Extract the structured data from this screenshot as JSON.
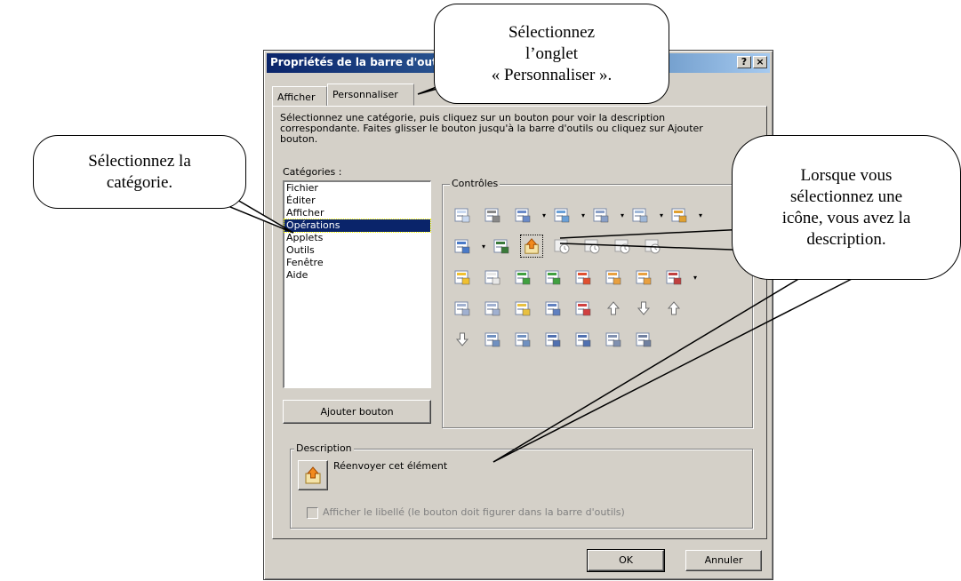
{
  "dialog": {
    "title": "Propriétés de la barre d'outils",
    "help_button": "?",
    "close_button": "×",
    "tabs": [
      "Afficher",
      "Personnaliser"
    ],
    "active_tab": "Personnaliser",
    "instructions": "Sélectionnez une catégorie, puis cliquez sur un bouton pour voir la description correspondante. Faites glisser le bouton jusqu'à la barre d'outils ou cliquez sur Ajouter bouton.",
    "categories_label": "Catégories :",
    "categories": [
      "Fichier",
      "Éditer",
      "Afficher",
      "Opérations",
      "Applets",
      "Outils",
      "Fenêtre",
      "Aide"
    ],
    "selected_category": "Opérations",
    "controls_label": "Contrôles",
    "add_button": "Ajouter bouton",
    "description_label": "Description",
    "description_text": "Réenvoyer cet élément",
    "show_label_checkbox": "Afficher le libellé (le bouton doit figurer dans la barre d'outils)",
    "ok_button": "OK",
    "cancel_button": "Annuler"
  },
  "callouts": {
    "tab": "Sélectionnez\nl’onglet\n« Personnaliser ».",
    "category": "Sélectionnez la\ncatégorie.",
    "icon": "Lorsque vous\nsélectionnez une\nicône, vous avez la\ndescription."
  },
  "colors": {
    "face": "#d4d0c8",
    "title_start": "#0a246a",
    "title_end": "#a6caf0",
    "selection": "#0a246a"
  }
}
